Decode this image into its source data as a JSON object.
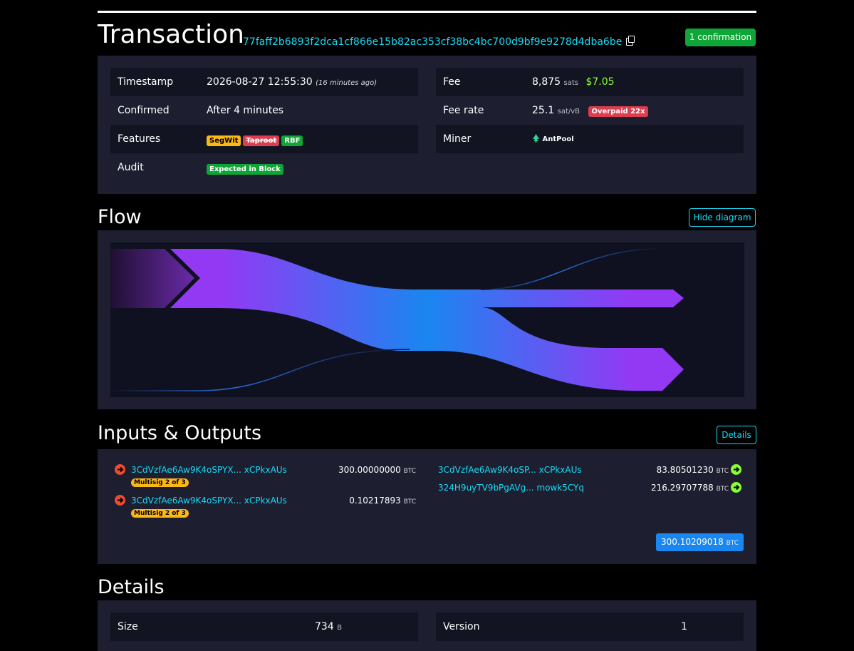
{
  "header": {
    "title": "Transaction",
    "txid": "77faff2b6893f2dca1cf866e15b82ac353cf38bc4bc700d9bf9e9278d4dba6be",
    "confirmation_badge": "1 confirmation"
  },
  "summary": {
    "timestamp_label": "Timestamp",
    "timestamp_value": "2026-08-27 12:55:30",
    "timestamp_relative": "(16 minutes ago)",
    "confirmed_label": "Confirmed",
    "confirmed_value": "After 4 minutes",
    "features_label": "Features",
    "features": [
      "SegWit",
      "Taproot",
      "RBF"
    ],
    "audit_label": "Audit",
    "audit_value": "Expected in Block",
    "fee_label": "Fee",
    "fee_sats": "8,875",
    "fee_sats_unit": "sats",
    "fee_usd": "$7.05",
    "fee_rate_label": "Fee rate",
    "fee_rate_value": "25.1",
    "fee_rate_unit": "sat/vB",
    "overpaid_badge": "Overpaid 22x",
    "miner_label": "Miner",
    "miner_value": "AntPool"
  },
  "flow": {
    "title": "Flow",
    "hide_button": "Hide diagram"
  },
  "io": {
    "title": "Inputs & Outputs",
    "details_button": "Details",
    "inputs": [
      {
        "address": "3CdVzfAe6Aw9K4oSPYX... xCPkxAUs",
        "amount": "300.00000000",
        "unit": "BTC",
        "badge": "Multisig 2 of 3"
      },
      {
        "address": "3CdVzfAe6Aw9K4oSPYX... xCPkxAUs",
        "amount": "0.10217893",
        "unit": "BTC",
        "badge": "Multisig 2 of 3"
      }
    ],
    "outputs": [
      {
        "address": "3CdVzfAe6Aw9K4oSP... xCPkxAUs",
        "amount": "83.80501230",
        "unit": "BTC"
      },
      {
        "address": "324H9uyTV9bPgAVg... mowk5CYq",
        "amount": "216.29707788",
        "unit": "BTC"
      }
    ],
    "total": "300.10209018",
    "total_unit": "BTC"
  },
  "details": {
    "title": "Details",
    "size_label": "Size",
    "size_value": "734",
    "size_unit": "B",
    "version_label": "Version",
    "version_value": "1"
  },
  "colors": {
    "accent": "#1bd8f4",
    "panel": "#1d1f31",
    "success": "#0fa638",
    "warning": "#fcb817",
    "danger": "#dd3d50",
    "flow_start": "#9339f4",
    "flow_mid": "#105fb0"
  }
}
